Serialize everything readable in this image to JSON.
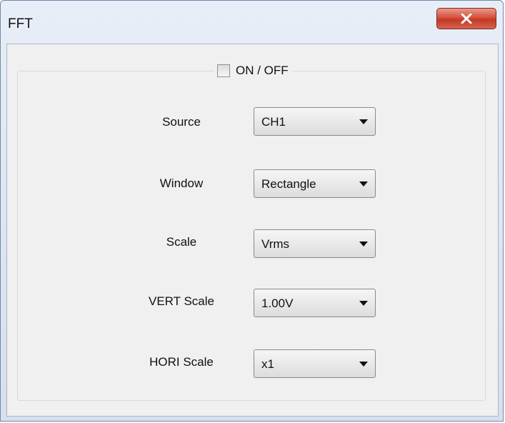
{
  "window": {
    "title": "FFT",
    "close_icon": "close-icon"
  },
  "toggle": {
    "label": "ON / OFF",
    "checked": false
  },
  "fields": [
    {
      "label": "Source",
      "value": "CH1"
    },
    {
      "label": "Window",
      "value": "Rectangle"
    },
    {
      "label": "Scale",
      "value": "Vrms"
    },
    {
      "label": "VERT Scale",
      "value": "1.00V"
    },
    {
      "label": "HORI Scale",
      "value": "x1"
    }
  ]
}
